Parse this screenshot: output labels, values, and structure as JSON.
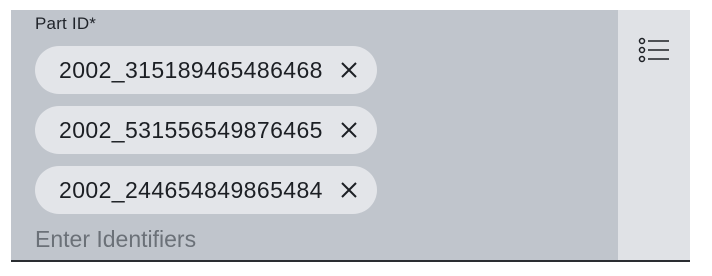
{
  "field": {
    "label": "Part ID*",
    "placeholder": "Enter Identifiers",
    "value": ""
  },
  "chips": [
    {
      "label": "2002_315189465486468",
      "remove_icon": "close-icon"
    },
    {
      "label": "2002_531556549876465",
      "remove_icon": "close-icon"
    },
    {
      "label": "2002_244654849865484",
      "remove_icon": "close-icon"
    }
  ],
  "side_button": {
    "icon": "list-icon"
  },
  "colors": {
    "field_background": "#c0c5cc",
    "side_background": "#e0e2e6",
    "chip_background": "#e3e5e9",
    "text": "#1c1f24",
    "placeholder": "#6b7178",
    "underline": "#2a2d31"
  }
}
